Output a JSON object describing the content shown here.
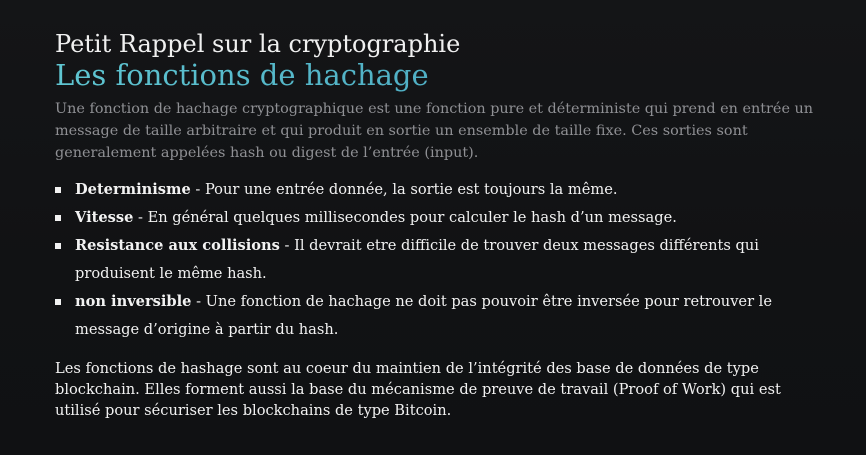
{
  "slide": {
    "supertitle": "Petit Rappel sur la cryptographie",
    "title": "Les fonctions de hachage",
    "intro": "Une fonction de hachage cryptographique est une fonction pure et déterministe qui prend en entrée un message de taille arbitraire et qui produit en sortie un ensemble de taille fixe. Ces sorties sont generalement appelées hash ou digest de l’entrée (input).",
    "features": [
      {
        "term": "Determinisme",
        "text": " - Pour une entrée donnée, la sortie est toujours la même."
      },
      {
        "term": "Vitesse",
        "text": " - En général quelques millisecondes pour calculer le hash d’un message."
      },
      {
        "term": "Resistance aux collisions",
        "text": " - Il devrait etre difficile de trouver deux messages différents qui produisent le même hash."
      },
      {
        "term": "non inversible",
        "text": " - Une fonction de hachage ne doit pas pouvoir être inversée pour retrouver le message d’origine à partir du hash."
      }
    ],
    "conclusion": "Les fonctions de hashage sont au coeur du maintien de l’intégrité des base de données de type blockchain. Elles forment aussi la base du mécanisme de preuve de travail (Proof of Work) qui est utilisé pour sécuriser les blockchains de type Bitcoin."
  },
  "colors": {
    "background": "#111214",
    "title_gradient_start": "#5fc6d2",
    "title_gradient_end": "#3f97b6",
    "intro_text": "#8f9094",
    "body_text": "#f2f2f2"
  }
}
